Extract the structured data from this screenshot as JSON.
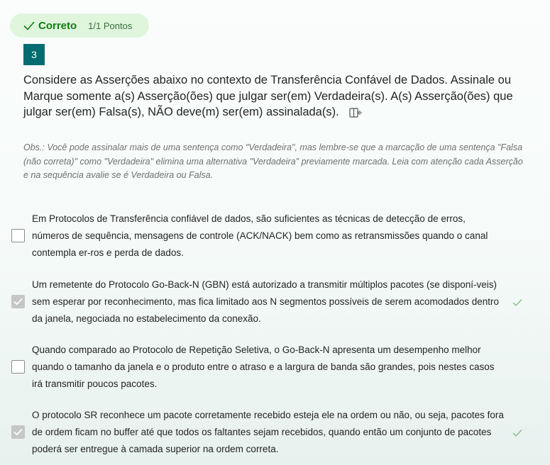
{
  "status": {
    "label": "Correto",
    "points": "1/1 Pontos"
  },
  "question": {
    "number": "3",
    "text": "Considere as Asserções abaixo no contexto de Transferência Confável de Dados. Assinale ou Marque somente a(s) Asserção(ões) que julgar ser(em) Verdadeira(s). A(s) Asserção(ões) que julgar ser(em) Falsa(s), NÃO deve(m) ser(em) assinalada(s).",
    "note": "Obs.: Você pode assinalar mais de uma sentença como \"Verdadeira\", mas lembre-se que a marcação de uma sentença \"Falsa (não correta)\" como \"Verdadeira\" elimina uma alternativa \"Verdadeira\" previamente marcada. Leia com atenção cada Asserção e na sequência avalie se é Verdadeira ou Falsa."
  },
  "options": [
    {
      "text": "Em Protocolos de Transferência confiável de dados, são suficientes as técnicas de detecção de erros, números de sequência, mensagens de controle (ACK/NACK) bem como as retransmissões quando o canal contempla er-ros e perda de dados.",
      "checked": false,
      "correct": false
    },
    {
      "text": "Um remetente do Protocolo Go-Back-N (GBN) está autorizado a transmitir múltiplos pacotes (se disponí-veis) sem esperar por reconhecimento, mas fica limitado aos N segmentos possíveis de serem acomodados dentro da janela, negociada no estabelecimento da conexão.",
      "checked": true,
      "correct": true
    },
    {
      "text": "Quando comparado ao Protocolo de Repetição Seletiva, o Go-Back-N apresenta um desempenho melhor quando o tamanho da janela e o produto entre o atraso e a largura de banda são grandes, pois nestes casos irá transmitir poucos pacotes.",
      "checked": false,
      "correct": false
    },
    {
      "text": "O protocolo SR reconhece um pacote corretamente recebido esteja ele na ordem ou não, ou seja, pacotes fora de ordem ficam no buffer até que todos os faltantes sejam recebidos, quando então um conjunto de pacotes poderá ser entregue à camada superior na ordem correta.",
      "checked": true,
      "correct": true
    }
  ],
  "colors": {
    "accent": "#036c70",
    "success": "#107c10",
    "success_bg": "#dff6dd"
  },
  "icons": {
    "status": "checkmark-icon",
    "reader": "immersive-reader-icon",
    "correct": "checkmark-icon"
  }
}
